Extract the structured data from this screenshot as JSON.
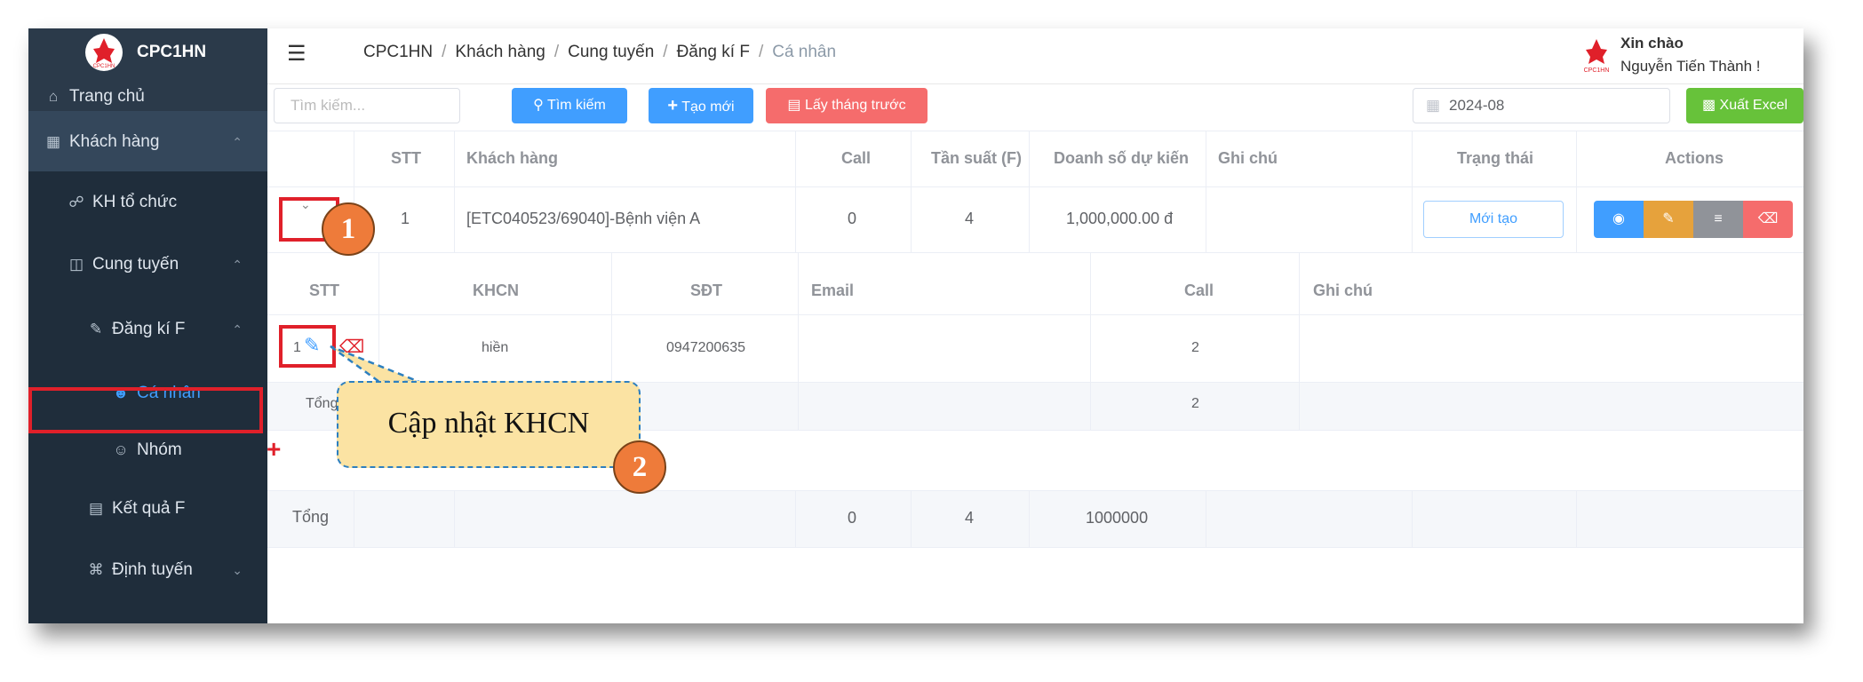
{
  "brand": {
    "name": "CPC1HN",
    "logo_text": "CPC1HN"
  },
  "sidebar": {
    "items": [
      {
        "label": "Trang chủ"
      },
      {
        "label": "Khách hàng"
      },
      {
        "label": "KH tổ chức"
      },
      {
        "label": "Cung tuyến"
      },
      {
        "label": "Đăng kí F"
      },
      {
        "label": "Cá nhân"
      },
      {
        "label": "Nhóm"
      },
      {
        "label": "Kết quả F"
      },
      {
        "label": "Định tuyến"
      }
    ]
  },
  "header": {
    "breadcrumb": [
      "CPC1HN",
      "Khách hàng",
      "Cung tuyến",
      "Đăng kí F",
      "Cá nhân"
    ],
    "greeting": "Xin chào",
    "user_name": "Nguyễn Tiến Thành !"
  },
  "toolbar": {
    "search_placeholder": "Tìm kiếm...",
    "search_button": "Tìm kiếm",
    "create_button": "Tạo mới",
    "prev_month_button": "Lấy tháng trước",
    "month_value": "2024-08",
    "export_button": "Xuất Excel"
  },
  "main_table": {
    "headers": [
      "STT",
      "Khách hàng",
      "Call",
      "Tần suất (F)",
      "Doanh số dự kiến",
      "Ghi chú",
      "Trạng thái",
      "Actions"
    ],
    "row": {
      "stt": "1",
      "customer": "[ETC040523/69040]-Bệnh viện A",
      "call": "0",
      "frequency": "4",
      "expected_sales": "1,000,000.00 đ",
      "note": "",
      "status": "Mới tạo"
    },
    "total": {
      "label": "Tổng",
      "call": "0",
      "frequency": "4",
      "sales": "1000000"
    }
  },
  "sub_table": {
    "headers": [
      "STT",
      "KHCN",
      "SĐT",
      "Email",
      "Call",
      "Ghi chú"
    ],
    "row": {
      "stt": "1",
      "khcn": "hiền",
      "phone": "0947200635",
      "email": "",
      "call": "2",
      "note": ""
    },
    "total": {
      "label": "Tổng",
      "call": "2"
    },
    "add_symbol": "+"
  },
  "annotations": {
    "callout_1": "1",
    "callout_2": "2",
    "bubble_text": "Cập nhật KHCN"
  },
  "colors": {
    "sidebar": "#2b3a4a",
    "primary": "#409eff",
    "danger": "#f56c6c",
    "success": "#67c23a",
    "warning": "#e6a23c",
    "highlight": "#e0202a"
  }
}
